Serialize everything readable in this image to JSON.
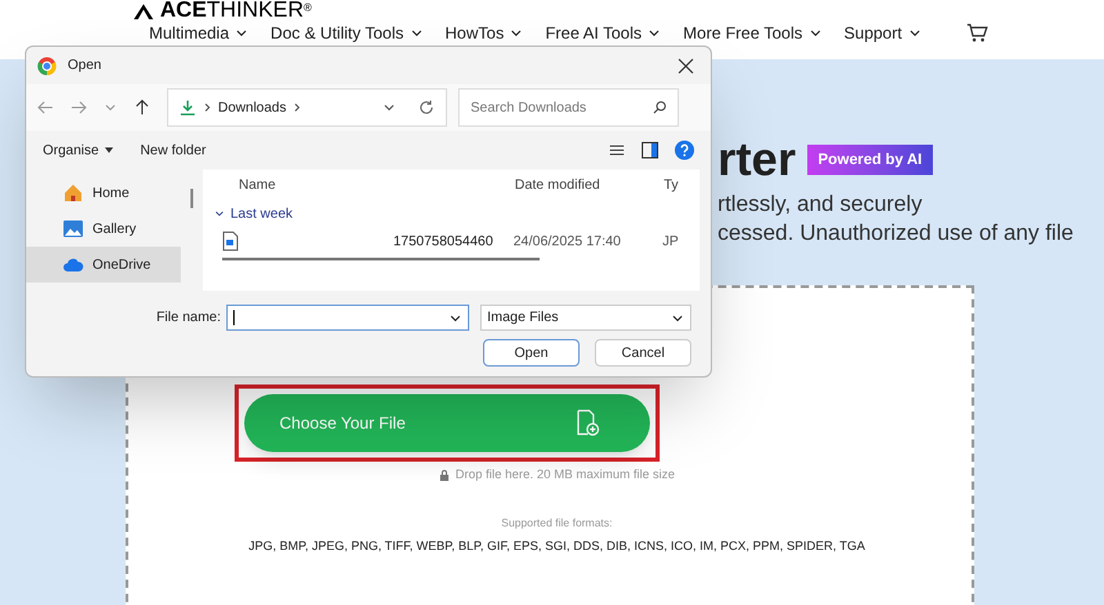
{
  "site": {
    "logo_bold": "ACE",
    "logo_rest": "THINKER",
    "logo_mark": "®",
    "nav": [
      {
        "label": "Multimedia"
      },
      {
        "label": "Doc & Utility Tools"
      },
      {
        "label": "HowTos"
      },
      {
        "label": "Free AI Tools"
      },
      {
        "label": "More Free Tools"
      },
      {
        "label": "Support"
      }
    ]
  },
  "hero": {
    "title_fragment": "rter",
    "badge": "Powered by AI",
    "subtitle_lines": [
      "rtlessly, and securely",
      "cessed. Unauthorized use of any file"
    ]
  },
  "upload": {
    "button": "Choose Your File",
    "drop_note": "Drop file here. 20 MB maximum file size",
    "formats_label": "Supported file formats:",
    "formats": "JPG, BMP, JPEG, PNG, TIFF, WEBP, BLP, GIF, EPS, SGI, DDS, DIB, ICNS, ICO, IM, PCX, PPM, SPIDER, TGA"
  },
  "dialog": {
    "title": "Open",
    "path": "Downloads",
    "search_placeholder": "Search Downloads",
    "organise": "Organise",
    "new_folder": "New folder",
    "sidebar": [
      {
        "label": "Home",
        "kind": "home",
        "selected": false
      },
      {
        "label": "Gallery",
        "kind": "gallery",
        "selected": false
      },
      {
        "label": "OneDrive",
        "kind": "cloud",
        "selected": true
      }
    ],
    "columns": [
      "Name",
      "Date modified",
      "Ty"
    ],
    "groups": [
      {
        "label": "Last week",
        "files": [
          {
            "name": "1750758054460",
            "date": "24/06/2025 17:40",
            "type": "JP"
          }
        ]
      }
    ],
    "file_name_label": "File name:",
    "file_type": "Image Files",
    "open": "Open",
    "cancel": "Cancel"
  }
}
